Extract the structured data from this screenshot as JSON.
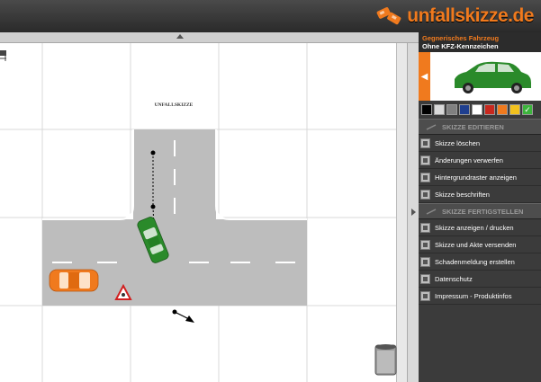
{
  "header": {
    "logo_text": "unfallskizze.de"
  },
  "canvas": {
    "watermark": "UNFALLSKIZZE"
  },
  "vehicle_panel": {
    "title": "Gegnerisches Fahrzeug",
    "subtitle": "Ohne KFZ-Kennzeichen",
    "selected_color": "#2a8a2a",
    "swatches": [
      "#000000",
      "#d9d9d9",
      "#808080",
      "#1f3f8f",
      "#ffffff",
      "#c8281e",
      "#f07a1e",
      "#f2c21e",
      "#3cb43c"
    ]
  },
  "sections": {
    "edit_title": "SKIZZE EDITIEREN",
    "finish_title": "SKIZZE FERTIGSTELLEN"
  },
  "edit_items": [
    "Skizze löschen",
    "Änderungen verwerfen",
    "Hintergrundraster anzeigen",
    "Skizze beschriften"
  ],
  "finish_items": [
    "Skizze anzeigen / drucken",
    "Skizze und Akte versenden",
    "Schadenmeldung erstellen",
    "Datenschutz",
    "Impressum - Produktinfos"
  ],
  "colors": {
    "accent": "#f07a1e",
    "road": "#bdbdbd"
  }
}
